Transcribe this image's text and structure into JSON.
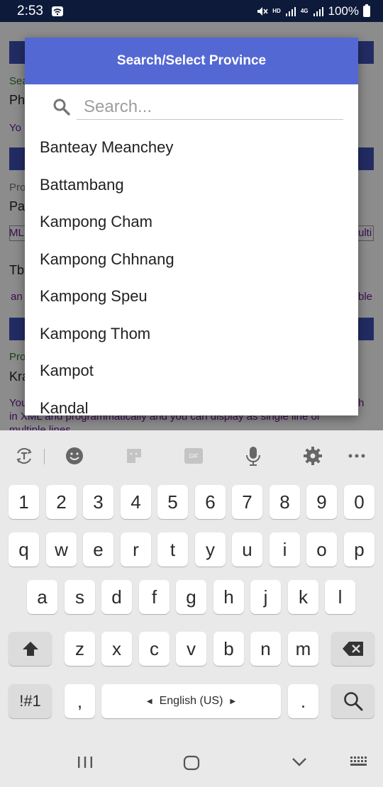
{
  "status_bar": {
    "time": "2:53",
    "battery": "100%",
    "hd_label": "HD",
    "network_label": "4G"
  },
  "background_app": {
    "label_1": "Sea",
    "value_1": "Ph",
    "hint_1": "Yo",
    "label_2": "Pro",
    "value_2": "Pa",
    "box_left": "ML",
    "box_right": "ulti",
    "value_3": "Tb",
    "hint_2": "an",
    "hint_2_right": "ble",
    "label_3": "Pro",
    "value_4": "Kra",
    "hint_3_line1": "You",
    "hint_3_right": "h",
    "hint_3_line2": "in XML and programmatically and you can display as single line or",
    "hint_3_line3": "multiple lines"
  },
  "dialog": {
    "title": "Search/Select Province",
    "search_placeholder": "Search...",
    "items": [
      "Banteay Meanchey",
      "Battambang",
      "Kampong Cham",
      "Kampong Chhnang",
      "Kampong Speu",
      "Kampong Thom",
      "Kampot",
      "Kandal"
    ]
  },
  "keyboard": {
    "number_row": [
      "1",
      "2",
      "3",
      "4",
      "5",
      "6",
      "7",
      "8",
      "9",
      "0"
    ],
    "row1": [
      "q",
      "w",
      "e",
      "r",
      "t",
      "y",
      "u",
      "i",
      "o",
      "p"
    ],
    "row2": [
      "a",
      "s",
      "d",
      "f",
      "g",
      "h",
      "j",
      "k",
      "l"
    ],
    "row3": [
      "z",
      "x",
      "c",
      "v",
      "b",
      "n",
      "m"
    ],
    "symbols_key": "!#1",
    "comma_key": ",",
    "space_label": "English (US)",
    "period_key": ".",
    "gif_label": "GIF",
    "toolbar_icons": [
      "translate-icon",
      "emoji-icon",
      "sticker-icon",
      "gif-icon",
      "microphone-icon",
      "settings-icon",
      "more-icon"
    ]
  },
  "colors": {
    "dialog_header": "#5468d4",
    "status_bar": "#0e1a3a",
    "keyboard_bg": "#e9e9e9"
  }
}
